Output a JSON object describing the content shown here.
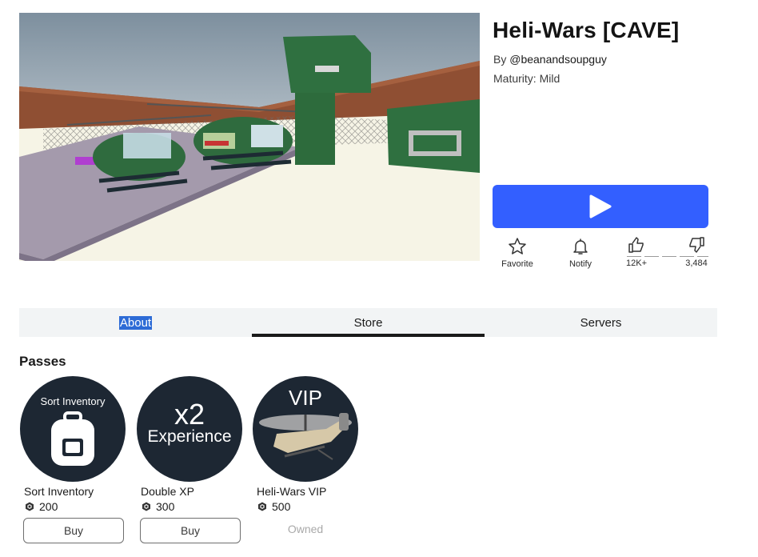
{
  "game": {
    "title": "Heli-Wars [CAVE]",
    "by_prefix": "By",
    "creator": "@beanandsoupguy",
    "maturity": "Maturity: Mild"
  },
  "actions": {
    "favorite_label": "Favorite",
    "notify_label": "Notify",
    "upvotes": "12K+",
    "downvotes": "3,484"
  },
  "tabs": [
    {
      "label": "About",
      "selected_text": true
    },
    {
      "label": "Store",
      "active": true
    },
    {
      "label": "Servers"
    }
  ],
  "passes": {
    "heading": "Passes",
    "items": [
      {
        "name": "Sort Inventory",
        "price": "200",
        "action": "Buy",
        "image_text": "Sort Inventory",
        "icon": "backpack-icon"
      },
      {
        "name": "Double XP",
        "price": "300",
        "action": "Buy",
        "image_text_1": "x2",
        "image_text_2": "Experience"
      },
      {
        "name": "Heli-Wars VIP",
        "price": "500",
        "action": "Owned",
        "image_text": "VIP",
        "icon": "helicopter-icon"
      }
    ]
  },
  "colors": {
    "play_button": "#335fff",
    "pass_bg": "#1d2733",
    "tab_bar": "#f2f4f5",
    "selection": "#2d6bd6"
  },
  "icons": [
    "play-icon",
    "star-icon",
    "bell-icon",
    "thumbs-up-icon",
    "thumbs-down-icon",
    "robux-icon"
  ]
}
